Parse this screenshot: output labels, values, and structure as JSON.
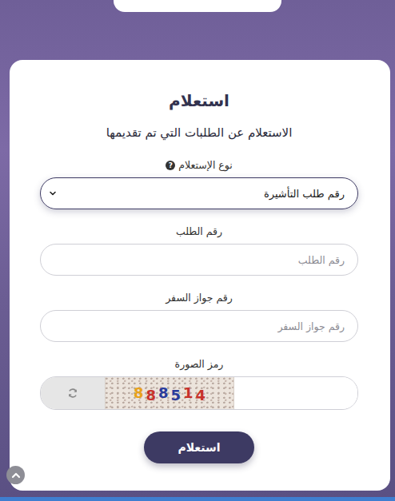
{
  "header": {
    "title": "استعلام",
    "subtitle": "الاستعلام عن الطلبات التي تم تقديمها"
  },
  "inquiry_type": {
    "label": "نوع الإستعلام",
    "help_icon": "?",
    "value": "رقم طلب التأشيرة"
  },
  "fields": [
    {
      "label": "رقم الطلب",
      "placeholder": "رقم الطلب"
    },
    {
      "label": "رقم جواز السفر",
      "placeholder": "رقم جواز السفر"
    }
  ],
  "captcha": {
    "label": "رمز الصورة",
    "digits": [
      {
        "text": "8",
        "color": "#e8a21c"
      },
      {
        "text": "8",
        "color": "#c8322c"
      },
      {
        "text": "8",
        "color": "#2a3c9c"
      },
      {
        "text": "5",
        "color": "#2a3c9c"
      },
      {
        "text": "1",
        "color": "#c8322c"
      },
      {
        "text": "4",
        "color": "#c8322c"
      }
    ]
  },
  "submit": "استعلام"
}
